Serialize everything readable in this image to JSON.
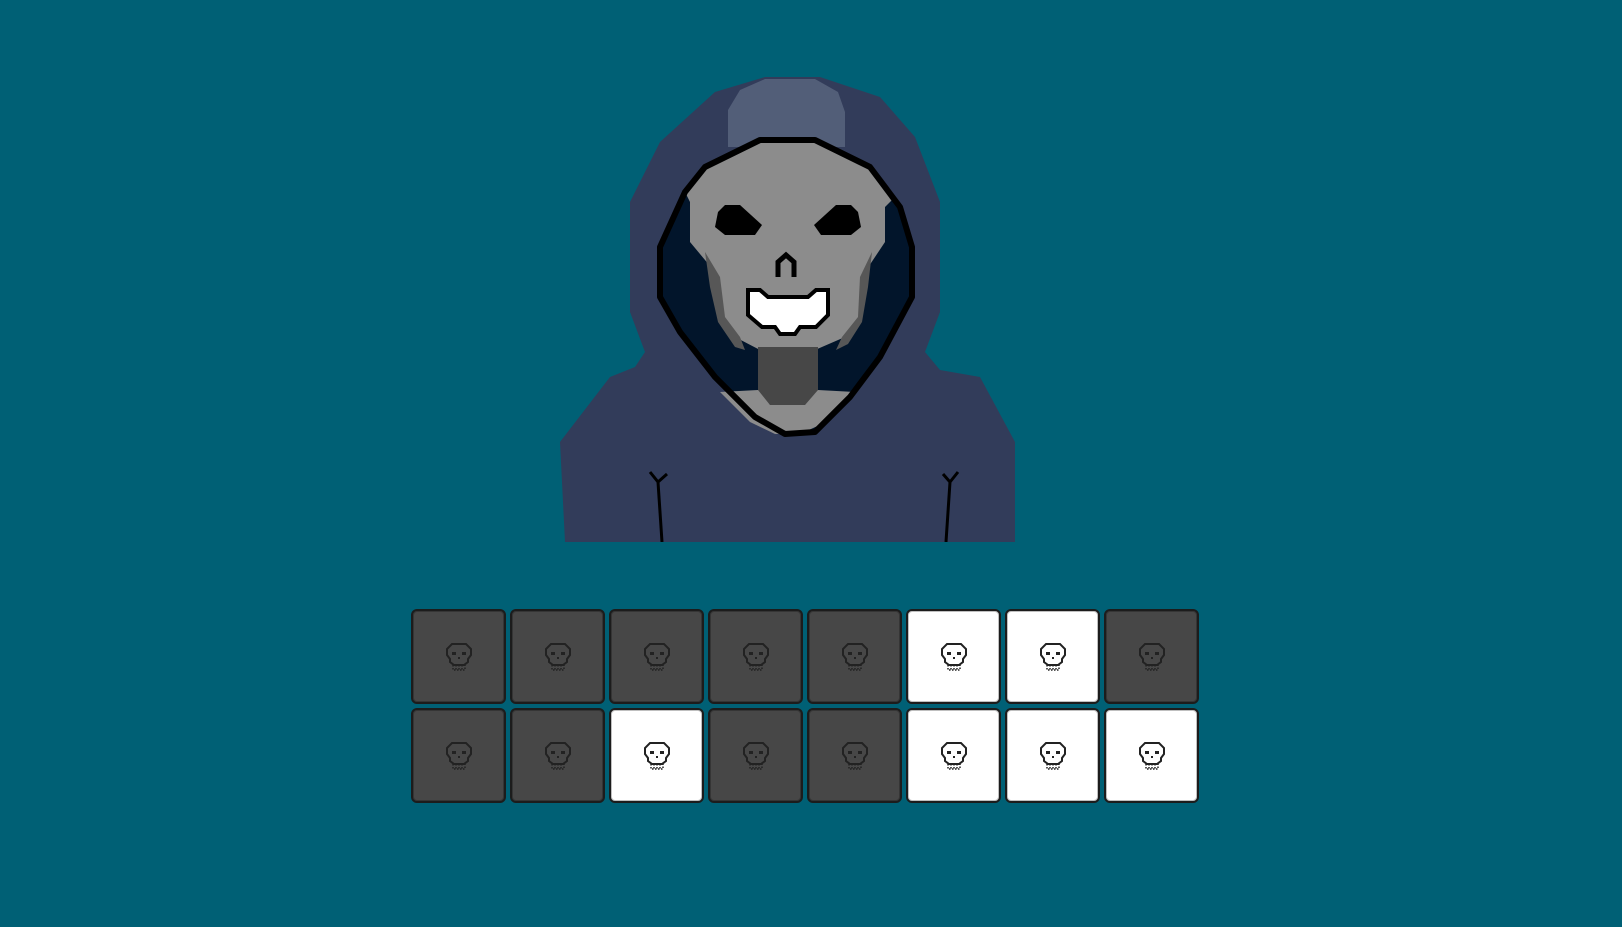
{
  "game": {
    "background": "#006075",
    "character": {
      "name": "hooded-skull-reaper",
      "hood_color": "#323c5a",
      "hood_highlight": "#525e78",
      "inner_hood_color": "#02152b",
      "skull_color": "#8c8c8c",
      "skull_shadow": "#575757",
      "teeth_color": "#ffffff",
      "outline_color": "#000000"
    },
    "tile_grid": {
      "rows": 2,
      "cols": 8,
      "icon": "skull-icon",
      "off_color": "#474747",
      "on_color": "#ffffff",
      "cells": [
        [
          false,
          false,
          false,
          false,
          false,
          true,
          true,
          false
        ],
        [
          false,
          false,
          true,
          false,
          false,
          true,
          true,
          true
        ]
      ]
    }
  }
}
